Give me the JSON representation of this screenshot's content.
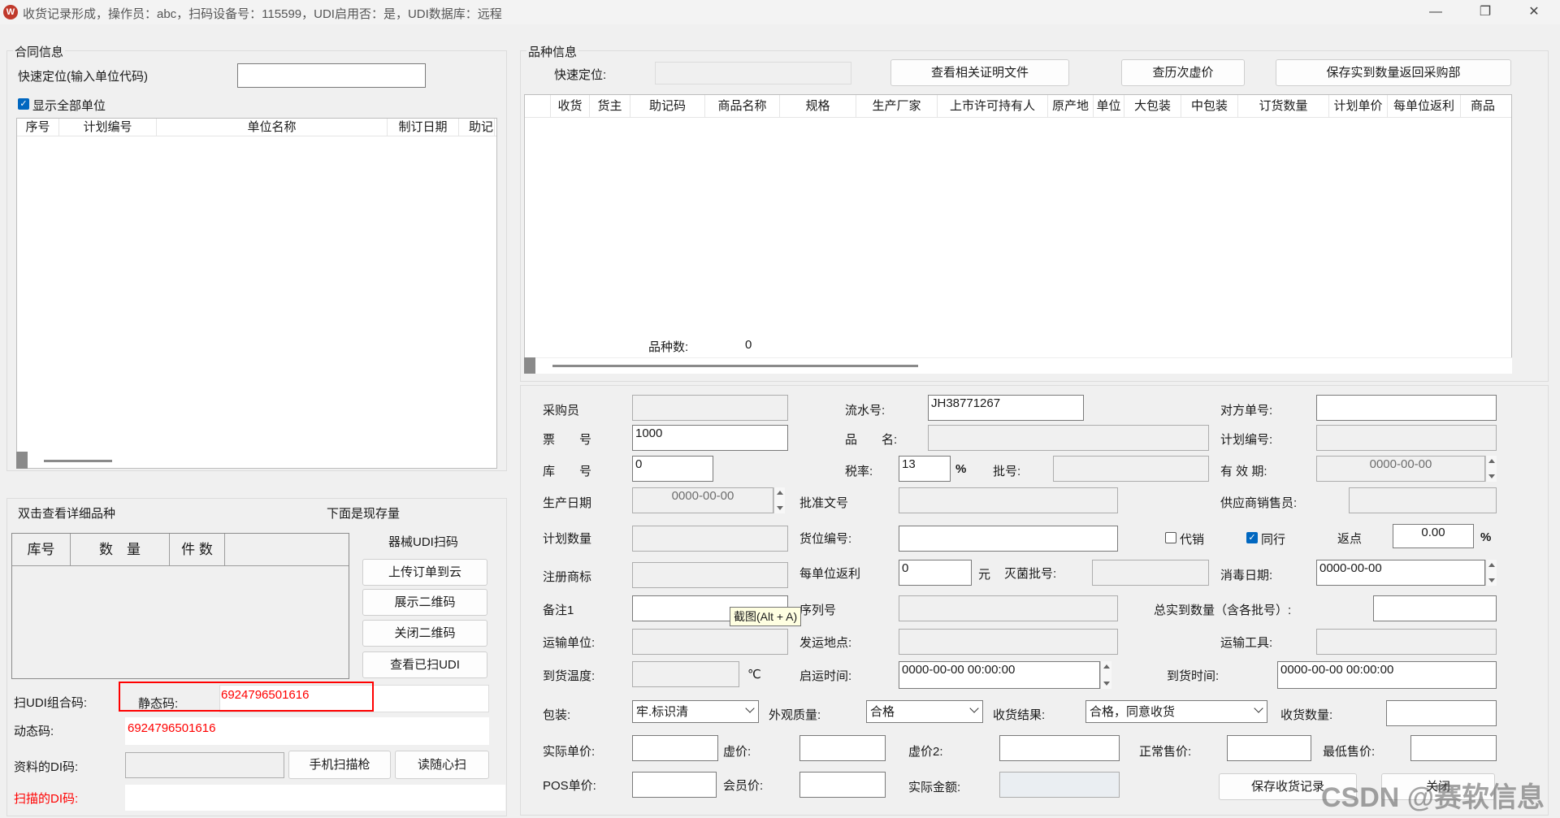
{
  "window": {
    "title": "收货记录形成，操作员：abc，扫码设备号：115599，UDI启用否：是，UDI数据库：远程",
    "app_icon": "W",
    "minimize": "—",
    "restore": "❐",
    "close": "✕"
  },
  "contract": {
    "legend": "合同信息",
    "quick_locate_label": "快速定位(输入单位代码)",
    "quick_locate_value": "",
    "show_all_label": "显示全部单位",
    "show_all_checked": true,
    "columns": [
      "序号",
      "计划编号",
      "单位名称",
      "制订日期",
      "助记"
    ]
  },
  "stock": {
    "dblclick_hint": "双击查看详细品种",
    "stock_hint": "下面是现存量",
    "columns": [
      "库号",
      "数　量",
      "件 数"
    ],
    "udi_title": "器械UDI扫码",
    "buttons": [
      "上传订单到云",
      "展示二维码",
      "关闭二维码",
      "查看已扫UDI"
    ]
  },
  "udi": {
    "combo_label": "扫UDI组合码:",
    "static_label": "静态码:",
    "static_value": "6924796501616",
    "dynamic_label": "动态码:",
    "dynamic_value": "6924796501616",
    "material_di_label": "资料的DI码:",
    "material_di_value": "",
    "scanned_di_label": "扫描的DI码:",
    "scanned_di_value": "",
    "phone_scan_button": "手机扫描枪",
    "read_scan_button": "读随心扫"
  },
  "variety": {
    "legend": "品种信息",
    "quick_locate_label": "快速定位:",
    "quick_locate_value": "",
    "btn_docs": "查看相关证明文件",
    "btn_history_price": "查历次虚价",
    "btn_save_qty": "保存实到数量返回采购部",
    "columns": [
      "收货",
      "货主",
      "助记码",
      "商品名称",
      "规格",
      "生产厂家",
      "上市许可持有人",
      "原产地",
      "单位",
      "大包装",
      "中包装",
      "订货数量",
      "计划单价",
      "每单位返利",
      "商品"
    ],
    "count_label": "品种数:",
    "count_value": "0"
  },
  "form": {
    "buyer_label": "采购员",
    "buyer_value": "",
    "serial_label": "流水号:",
    "serial_value": "JH38771267",
    "counter_no_label": "对方单号:",
    "counter_no_value": "",
    "ticket_label": "票　　号",
    "ticket_value": "1000",
    "product_name_label": "品　　名:",
    "product_name_value": "",
    "plan_no_label": "计划编号:",
    "plan_no_value": "",
    "warehouse_label": "库　　号",
    "warehouse_value": "0",
    "tax_label": "税率:",
    "tax_value": "13",
    "tax_unit": "%",
    "batch_label": "批号:",
    "batch_value": "",
    "expiry_label": "有 效 期:",
    "expiry_value": "0000-00-00",
    "prod_date_label": "生产日期",
    "prod_date_value": "0000-00-00",
    "approval_label": "批准文号",
    "approval_value": "",
    "supplier_sales_label": "供应商销售员:",
    "supplier_sales_value": "",
    "plan_qty_label": "计划数量",
    "plan_qty_value": "",
    "location_label": "货位编号:",
    "location_value": "",
    "consign_label": "代销",
    "consign_checked": false,
    "peer_label": "同行",
    "peer_checked": true,
    "rebate_pt_label": "返点",
    "rebate_pt_value": "0.00",
    "rebate_pt_unit": "%",
    "trademark_label": "注册商标",
    "trademark_value": "",
    "unit_rebate_label": "每单位返利",
    "unit_rebate_value": "0",
    "unit_rebate_unit": "元",
    "sterile_batch_label": "灭菌批号:",
    "sterile_batch_value": "",
    "disinfect_label": "消毒日期:",
    "disinfect_value": "0000-00-00",
    "remark_label": "备注1",
    "remark_value": "",
    "seq_label": "序列号",
    "seq_value": "",
    "total_qty_label": "总实到数量（含各批号）:",
    "total_qty_value": "",
    "transport_unit_label": "运输单位:",
    "transport_unit_value": "",
    "ship_place_label": "发运地点:",
    "ship_place_value": "",
    "transport_tool_label": "运输工具:",
    "transport_tool_value": "",
    "arrive_temp_label": "到货温度:",
    "arrive_temp_value": "",
    "arrive_temp_unit": "℃",
    "depart_time_label": "启运时间:",
    "depart_time_value": "0000-00-00 00:00:00",
    "arrive_time_label": "到货时间:",
    "arrive_time_value": "0000-00-00 00:00:00",
    "package_label": "包装:",
    "package_value": "牢.标识清",
    "appearance_label": "外观质量:",
    "appearance_value": "合格",
    "receive_result_label": "收货结果:",
    "receive_result_value": "合格，同意收货",
    "receive_qty_label": "收货数量:",
    "receive_qty_value": "",
    "actual_price_label": "实际单价:",
    "actual_price_value": "",
    "virtual_price_label": "虚价:",
    "virtual_price_value": "",
    "virtual_price2_label": "虚价2:",
    "virtual_price2_value": "",
    "normal_price_label": "正常售价:",
    "normal_price_value": "",
    "min_price_label": "最低售价:",
    "min_price_value": "",
    "pos_price_label": "POS单价:",
    "pos_price_value": "",
    "member_price_label": "会员价:",
    "member_price_value": "",
    "actual_amount_label": "实际金额:",
    "actual_amount_value": "",
    "save_button": "保存收货记录",
    "close_button": "关闭"
  },
  "tooltip": "截图(Alt + A)",
  "watermark": "CSDN @赛软信息"
}
